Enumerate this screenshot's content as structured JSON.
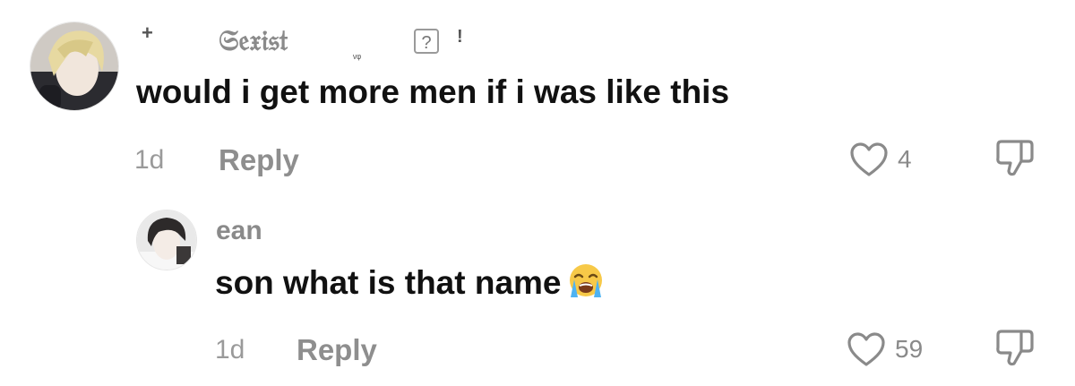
{
  "comments": [
    {
      "username": "𝔖𝔢𝔵𝔦𝔰𝔱",
      "decor_plus": "+",
      "decor_small": "ᵥᵩ",
      "badge_question": "?",
      "badge_exclaim": "!",
      "text": "would i get more men if i was like this",
      "time": "1d",
      "reply_label": "Reply",
      "likes": "4"
    },
    {
      "username": "ean",
      "text": "son what is that name",
      "time": "1d",
      "reply_label": "Reply",
      "likes": "59"
    }
  ],
  "icons": [
    "heart-outline-icon",
    "thumbs-down-icon",
    "loudly-crying-face-emoji"
  ],
  "colors": {
    "text_primary": "#111111",
    "text_secondary": "#8a8a8a",
    "background": "#ffffff"
  }
}
